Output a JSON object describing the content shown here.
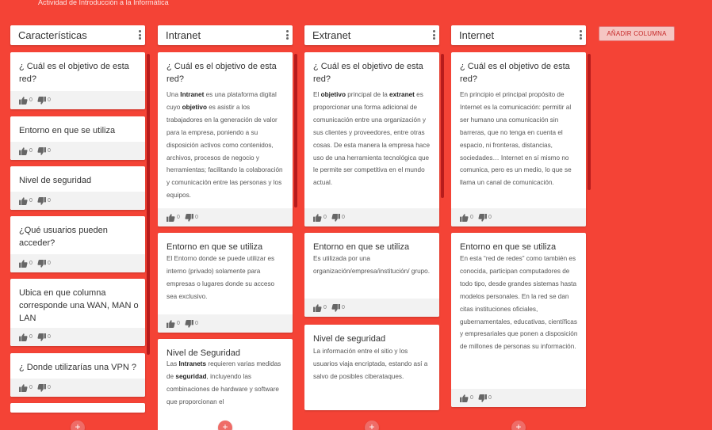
{
  "page": {
    "title": "Actividad de Introducción a la Informática"
  },
  "add_column_label": "AÑADIR COLUMNA",
  "add_post_symbol": "+",
  "vote_icons": {
    "like": "thumbs-up-icon",
    "dislike": "thumbs-down-icon"
  },
  "columns": [
    {
      "title": "Características",
      "cards": [
        {
          "title": "¿ Cuál es el objetivo de esta red?",
          "body": "",
          "likes": "0",
          "dislikes": "0"
        },
        {
          "title": "Entorno en que se utiliza",
          "body": "",
          "likes": "0",
          "dislikes": "0"
        },
        {
          "title": "Nivel de seguridad",
          "body": "",
          "likes": "0",
          "dislikes": "0"
        },
        {
          "title": "¿Qué usuarios pueden acceder?",
          "body": "",
          "likes": "0",
          "dislikes": "0"
        },
        {
          "title": "Ubica en que columna corresponde una WAN, MAN o LAN",
          "body": "",
          "likes": "0",
          "dislikes": "0"
        },
        {
          "title": "¿ Donde utilizarías una VPN ?",
          "body": "",
          "likes": "0",
          "dislikes": "0"
        }
      ]
    },
    {
      "title": "Intranet",
      "cards": [
        {
          "title": "¿ Cuál es el objetivo de esta red?",
          "body": "Una <b>Intranet</b> es una plataforma digital cuyo <b>objetivo</b> es asistir a los trabajadores en la generación de valor para la empresa, poniendo a su disposición activos como contenidos, archivos, procesos de negocio y herramientas; facilitando la colaboración y comunicación entre las personas y los equipos.",
          "likes": "0",
          "dislikes": "0"
        },
        {
          "title": "Entorno en que se utiliza",
          "body": "El Entorno donde se puede utilizar es interno (privado) solamente para empresas o lugares donde su acceso sea exclusivo.",
          "likes": "0",
          "dislikes": "0"
        },
        {
          "title": "Nivel de Seguridad",
          "body": "Las <b>Intranets</b> requieren varias medidas de <b>seguridad</b>, incluyendo las combinaciones de hardware y software que proporcionan el",
          "likes": "",
          "dislikes": ""
        }
      ]
    },
    {
      "title": "Extranet",
      "cards": [
        {
          "title": "¿ Cuál es el objetivo de esta red?",
          "body": "El <b>objetivo</b> principal de la <b>extranet</b> es proporcionar una forma adicional de comunicación entre una organización y sus clientes y proveedores, entre otras cosas. De esta manera la empresa hace uso de una herramienta tecnológica que le permite ser competitiva en el mundo actual.",
          "likes": "0",
          "dislikes": "0"
        },
        {
          "title": "Entorno en que se utiliza",
          "body": "Es utilizada por una organización/empresa/institución/ grupo.",
          "likes": "0",
          "dislikes": "0"
        },
        {
          "title": "Nivel de seguridad",
          "body": "La información entre el sitio y los usuarios viaja encriptada, estando así a salvo de posibles ciberataques.",
          "likes": "",
          "dislikes": ""
        }
      ]
    },
    {
      "title": "Internet",
      "cards": [
        {
          "title": "¿ Cuál es el objetivo de esta red?",
          "body": "En principio el principal propósito de Internet es la comunicación: permitir al ser humano una comunicación sin barreras, que no tenga en cuenta el espacio, ni fronteras, distancias, sociedades… Internet en sí mismo no comunica, pero es un medio, lo que se llama un canal de comunicación.",
          "likes": "0",
          "dislikes": "0"
        },
        {
          "title": "Entorno en que se utiliza",
          "body": "En esta “red de redes” como también es conocida, participan computadores de todo tipo, desde grandes sistemas hasta modelos personales. En la red se dan citas instituciones oficiales, gubernamentales, educativas, científicas y empresariales que ponen a disposición de millones de personas su información.",
          "likes": "0",
          "dislikes": "0"
        }
      ]
    }
  ]
}
